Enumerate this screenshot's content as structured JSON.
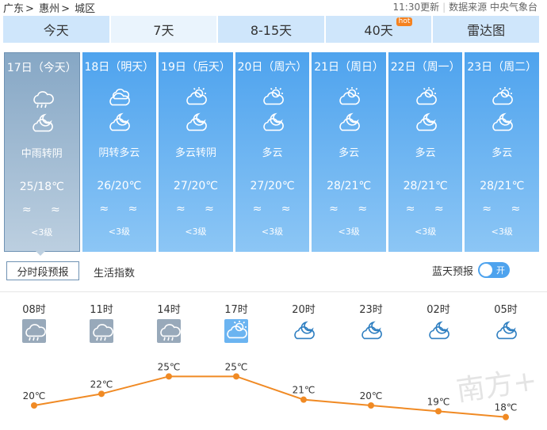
{
  "breadcrumb": [
    "广东",
    "惠州",
    "城区"
  ],
  "update_time": "11:30更新",
  "source_label": "数据来源",
  "source_name": "中央气象台",
  "tabs": [
    {
      "label": "今天",
      "active": false
    },
    {
      "label": "7天",
      "active": true
    },
    {
      "label": "8-15天",
      "active": false
    },
    {
      "label": "40天",
      "active": false,
      "badge": "hot"
    },
    {
      "label": "雷达图",
      "active": false
    }
  ],
  "days": [
    {
      "date": "17日（今天）",
      "icon_day": "rain-icon",
      "icon_night": "cloudy-night-icon",
      "desc": "中雨转阴",
      "temp": "25/18℃",
      "wind": "≈ ≈",
      "level": "<3级",
      "today": true
    },
    {
      "date": "18日（明天）",
      "icon_day": "overcast-icon",
      "icon_night": "cloudy-night-icon",
      "desc": "阴转多云",
      "temp": "26/20℃",
      "wind": "≈ ≈",
      "level": "<3级"
    },
    {
      "date": "19日（后天）",
      "icon_day": "partly-cloudy-icon",
      "icon_night": "cloudy-night-icon",
      "desc": "多云转阴",
      "temp": "27/20℃",
      "wind": "≈ ≈",
      "level": "<3级"
    },
    {
      "date": "20日（周六）",
      "icon_day": "partly-cloudy-icon",
      "icon_night": "cloudy-night-icon",
      "desc": "多云",
      "temp": "27/20℃",
      "wind": "≈ ≈",
      "level": "<3级"
    },
    {
      "date": "21日（周日）",
      "icon_day": "partly-cloudy-icon",
      "icon_night": "cloudy-night-icon",
      "desc": "多云",
      "temp": "28/21℃",
      "wind": "≈ ≈",
      "level": "<3级"
    },
    {
      "date": "22日（周一）",
      "icon_day": "partly-cloudy-icon",
      "icon_night": "cloudy-night-icon",
      "desc": "多云",
      "temp": "28/21℃",
      "wind": "≈ ≈",
      "level": "<3级"
    },
    {
      "date": "23日（周二）",
      "icon_day": "partly-cloudy-icon",
      "icon_night": "cloudy-night-icon",
      "desc": "多云",
      "temp": "28/21℃",
      "wind": "≈ ≈",
      "level": "<3级"
    }
  ],
  "subtabs": {
    "active": "分时段预报",
    "other": "生活指数"
  },
  "blue_sky": {
    "label": "蓝天预报",
    "toggle": "开"
  },
  "hourly": [
    {
      "time": "08时",
      "icon": "rain-icon",
      "temp": 20,
      "temp_label": "20℃"
    },
    {
      "time": "11时",
      "icon": "rain-icon",
      "temp": 22,
      "temp_label": "22℃"
    },
    {
      "time": "14时",
      "icon": "rain-icon",
      "temp": 25,
      "temp_label": "25℃"
    },
    {
      "time": "17时",
      "icon": "partly-cloudy-icon",
      "temp": 25,
      "temp_label": "25℃"
    },
    {
      "time": "20时",
      "icon": "cloudy-night-icon",
      "temp": 21,
      "temp_label": "21℃"
    },
    {
      "time": "23时",
      "icon": "cloudy-night-icon",
      "temp": 20,
      "temp_label": "20℃"
    },
    {
      "time": "02时",
      "icon": "cloudy-night-icon",
      "temp": 19,
      "temp_label": "19℃"
    },
    {
      "time": "05时",
      "icon": "cloudy-night-icon",
      "temp": 18,
      "temp_label": "18℃"
    }
  ],
  "colors": {
    "accent": "#4ea3ee",
    "line": "#f08a24",
    "today_bg": "#86a7c5",
    "tab_bg": "#cfe6fb"
  },
  "watermark": "南方+"
}
